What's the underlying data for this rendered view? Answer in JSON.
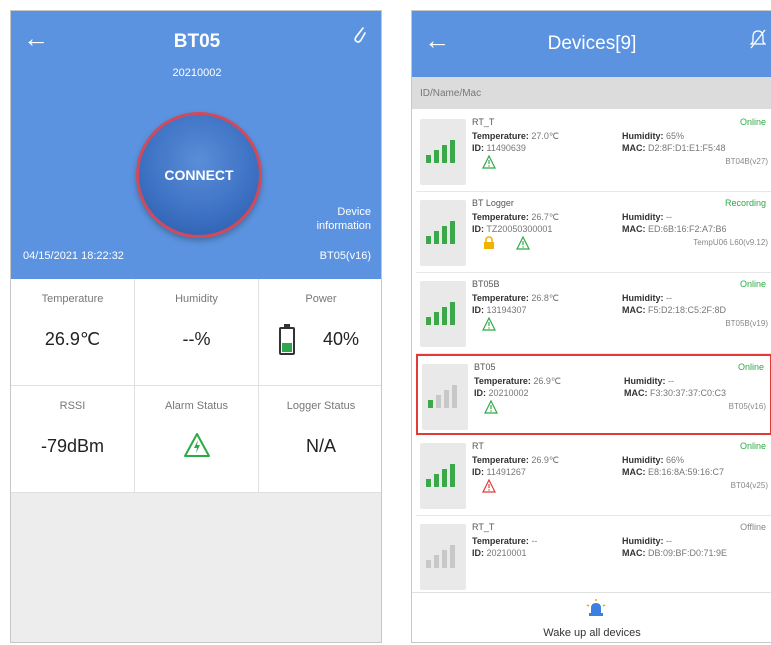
{
  "left": {
    "header": {
      "title": "BT05",
      "device_id": "20210002",
      "connect_label": "CONNECT",
      "device_info_label": "Device information",
      "datetime": "04/15/2021 18:22:32",
      "firmware": "BT05(v16)",
      "back_icon": "back-arrow-icon",
      "edit_icon": "paperclip-icon"
    },
    "metrics": [
      {
        "label": "Temperature",
        "value": "26.9℃"
      },
      {
        "label": "Humidity",
        "value": "--%"
      },
      {
        "label": "Power",
        "value": "40%",
        "battery_level": 0.4
      },
      {
        "label": "RSSI",
        "value": "-79dBm"
      },
      {
        "label": "Alarm Status",
        "icon": "warning-triangle-icon",
        "icon_color": "#2eaa45"
      },
      {
        "label": "Logger Status",
        "value": "N/A"
      }
    ]
  },
  "right": {
    "header": {
      "title": "Devices[9]",
      "back_icon": "back-arrow-icon",
      "bell_icon": "bell-off-icon"
    },
    "search_placeholder": "ID/Name/Mac",
    "devices": [
      {
        "name": "RT_T",
        "status": "Online",
        "temperature": "27.0℃",
        "humidity": "65%",
        "id": "11490639",
        "mac": "D2:8F:D1:E1:F5:48",
        "firmware": "BT04B(v27)",
        "signal": 4,
        "icons": [
          "warning-green"
        ]
      },
      {
        "name": "BT Logger",
        "status": "Recording",
        "temperature": "26.7℃",
        "humidity": "--",
        "id": "TZ20050300001",
        "mac": "ED:6B:16:F2:A7:B6",
        "firmware": "TempU06 L60(v9.12)",
        "signal": 4,
        "icons": [
          "lock",
          "warning-green"
        ]
      },
      {
        "name": "BT05B",
        "status": "Online",
        "temperature": "26.8℃",
        "humidity": "--",
        "id": "13194307",
        "mac": "F5:D2:18:C5:2F:8D",
        "firmware": "BT05B(v19)",
        "signal": 4,
        "icons": [
          "warning-green"
        ]
      },
      {
        "name": "BT05",
        "status": "Online",
        "temperature": "26.9℃",
        "humidity": "--",
        "id": "20210002",
        "mac": "F3:30:37:37:C0:C3",
        "firmware": "BT05(v16)",
        "signal": 1,
        "selected": true,
        "icons": [
          "warning-green"
        ]
      },
      {
        "name": "RT",
        "status": "Online",
        "temperature": "26.9℃",
        "humidity": "66%",
        "id": "11491267",
        "mac": "E8:16:8A:59:16:C7",
        "firmware": "BT04(v25)",
        "signal": 4,
        "icons": [
          "warning-red"
        ]
      },
      {
        "name": "RT_T",
        "status": "Offline",
        "temperature": "--",
        "humidity": "--",
        "id": "20210001",
        "mac": "DB:09:BF:D0:71:9E",
        "firmware": "",
        "signal": 0,
        "icons": []
      }
    ],
    "labels": {
      "temperature": "Temperature:",
      "humidity": "Humidity:",
      "id": "ID:",
      "mac": "MAC:"
    },
    "wake_all_label": "Wake up all devices",
    "wake_icon": "alarm-light-icon"
  },
  "colors": {
    "header_blue": "#5b93e0",
    "online_green": "#2eaa45",
    "alert_red": "#e03a3a"
  }
}
